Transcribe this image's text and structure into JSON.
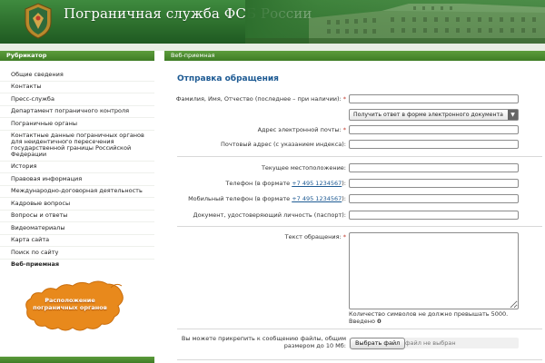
{
  "header": {
    "title": "Пограничная служба ФСБ России"
  },
  "sidebar": {
    "heading": "Рубрикатор",
    "items": [
      {
        "label": "Общие сведения"
      },
      {
        "label": "Контакты"
      },
      {
        "label": "Пресс-служба"
      },
      {
        "label": "Департамент пограничного контроля"
      },
      {
        "label": "Пограничные органы"
      },
      {
        "label": "Контактные данные пограничных органов для неидентичного пересечения государственной границы Российской Федерации"
      },
      {
        "label": "История"
      },
      {
        "label": "Правовая информация"
      },
      {
        "label": "Международно-договорная деятельность"
      },
      {
        "label": "Кадровые вопросы"
      },
      {
        "label": "Вопросы и ответы"
      },
      {
        "label": "Видеоматериалы"
      },
      {
        "label": "Карта сайта"
      },
      {
        "label": "Поиск по сайту"
      },
      {
        "label": "Веб-приемная",
        "active": true
      }
    ],
    "promo": {
      "line1": "Расположение",
      "line2": "пограничных органов",
      "color": "#e8891c"
    }
  },
  "main": {
    "heading": "Веб-приемная",
    "title": "Отправка обращения",
    "fields": {
      "fio": {
        "label": "Фамилия, Имя, Отчество (последнее – при наличии):",
        "required": "*",
        "value": ""
      },
      "reply_select": {
        "value": "Получить ответ в форме электронного документа"
      },
      "email": {
        "label": "Адрес электронной почты:",
        "required": "*",
        "value": ""
      },
      "postal": {
        "label": "Почтовый адрес (с указанием индекса):",
        "value": ""
      },
      "location": {
        "label": "Текущее местоположение:",
        "value": ""
      },
      "phone": {
        "label_pre": "Телефон (в формате ",
        "phone_example": "+7 495 1234567",
        "label_post": "):",
        "value": ""
      },
      "mobile": {
        "label_pre": "Мобильный телефон (в формате ",
        "phone_example": "+7 495 1234567",
        "label_post": "):",
        "value": ""
      },
      "document": {
        "label": "Документ, удостоверяющий личность (паспорт):",
        "value": ""
      },
      "message": {
        "label": "Текст обращения:",
        "required": "*",
        "value": ""
      }
    },
    "char_limit_note": "Количество символов не должно превышать 5000.",
    "entered_label": "Введено",
    "entered_count": "0",
    "attach": {
      "label_line1": "Вы можете прикрепить к сообщению файлы, общим",
      "label_line2": "размером до 10 Мб:",
      "button": "Выбрать файл",
      "status": "файл не выбран"
    }
  },
  "colors": {
    "header_green": "#2d6f2d",
    "accent_blue": "#1d5a93",
    "required_red": "#c0392b"
  }
}
